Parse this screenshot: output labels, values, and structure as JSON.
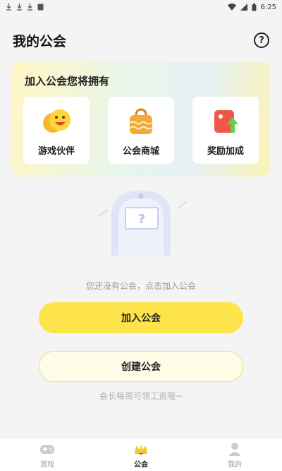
{
  "status_bar": {
    "time": "6:25"
  },
  "header": {
    "title": "我的公会",
    "help_glyph": "?"
  },
  "benefits": {
    "title": "加入公会您将拥有",
    "items": [
      {
        "label": "游戏伙伴",
        "icon": "smiley-icon"
      },
      {
        "label": "公会商城",
        "icon": "shopping-bag-icon"
      },
      {
        "label": "奖励加成",
        "icon": "reward-boost-icon"
      }
    ]
  },
  "empty_state": {
    "message": "您还没有公会，点击加入公会"
  },
  "actions": {
    "join_label": "加入公会",
    "create_label": "创建公会"
  },
  "hint": "会长每周可领工资哦~",
  "tabs": [
    {
      "label": "游戏",
      "active": false
    },
    {
      "label": "公会",
      "active": true
    },
    {
      "label": "我的",
      "active": false
    }
  ],
  "colors": {
    "accent": "#fde44a",
    "background": "#f4f4f4"
  }
}
